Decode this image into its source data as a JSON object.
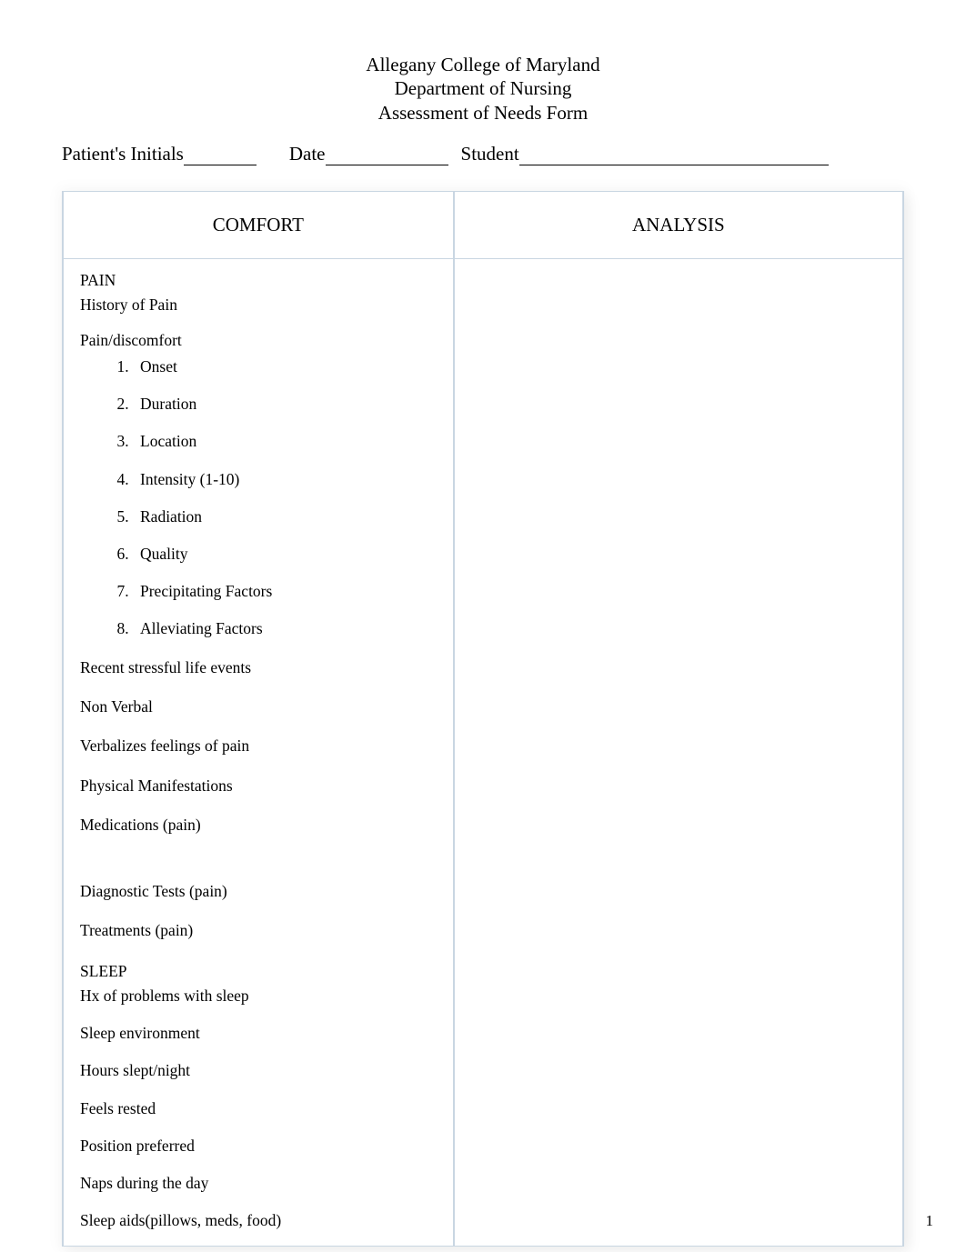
{
  "header": {
    "line1": "Allegany College of Maryland",
    "line2": "Department of Nursing",
    "line3": "Assessment of Needs Form"
  },
  "meta": {
    "patient_initials_label": "Patient's Initials",
    "date_label": "Date",
    "student_label": "Student",
    "patient_initials_value": "",
    "date_value": "",
    "student_value": ""
  },
  "table": {
    "col1_header": "COMFORT",
    "col2_header": "ANALYSIS"
  },
  "comfort": {
    "pain_heading": "PAIN",
    "history_of_pain": "History of Pain",
    "pain_discomfort_label": "Pain/discomfort",
    "pd_items": [
      "Onset",
      "Duration",
      "Location",
      "Intensity (1-10)",
      "Radiation",
      "Quality",
      "Precipitating Factors",
      "Alleviating Factors"
    ],
    "recent_stress": "Recent stressful life events",
    "non_verbal": "Non Verbal",
    "verbalizes": "Verbalizes feelings of pain",
    "physical_manifestations": "Physical Manifestations",
    "medications": "Medications (pain)",
    "diagnostic_tests": "Diagnostic Tests (pain)",
    "treatments": "Treatments (pain)",
    "sleep_heading": "SLEEP",
    "hx_sleep": "Hx of problems with sleep",
    "sleep_env": "Sleep environment",
    "hours_slept": "Hours slept/night",
    "feels_rested": "Feels rested",
    "position_preferred": "Position preferred",
    "naps": "Naps during the day",
    "sleep_aids": "Sleep aids(pillows, meds, food)"
  },
  "page_number": "1"
}
